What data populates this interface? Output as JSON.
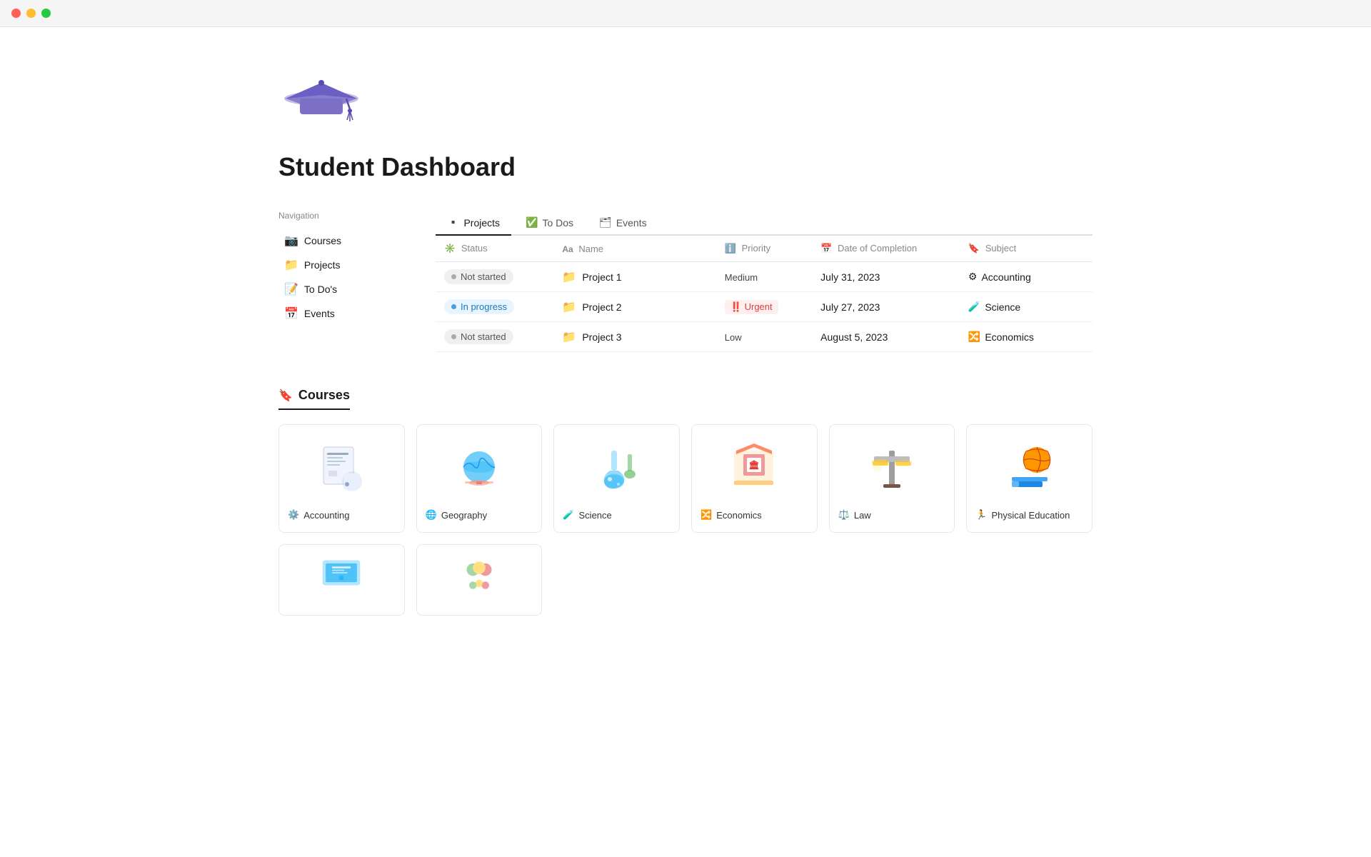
{
  "titlebar": {
    "buttons": [
      "close",
      "minimize",
      "maximize"
    ]
  },
  "page": {
    "icon": "🎓",
    "title": "Student Dashboard"
  },
  "navigation": {
    "heading": "Navigation",
    "items": [
      {
        "id": "courses",
        "icon": "📷",
        "label": "Courses"
      },
      {
        "id": "projects",
        "icon": "📁",
        "label": "Projects"
      },
      {
        "id": "todos",
        "icon": "📝",
        "label": "To Do's"
      },
      {
        "id": "events",
        "icon": "📅",
        "label": "Events"
      }
    ]
  },
  "tabs": [
    {
      "id": "projects",
      "icon": "▪",
      "label": "Projects",
      "active": true
    },
    {
      "id": "todos",
      "icon": "✓",
      "label": "To Dos",
      "active": false
    },
    {
      "id": "events",
      "icon": "▦",
      "label": "Events",
      "active": false
    }
  ],
  "table": {
    "columns": [
      {
        "id": "status",
        "icon": "✳",
        "label": "Status"
      },
      {
        "id": "name",
        "icon": "Aa",
        "label": "Name"
      },
      {
        "id": "priority",
        "icon": "ℹ",
        "label": "Priority"
      },
      {
        "id": "date",
        "icon": "📅",
        "label": "Date of Completion"
      },
      {
        "id": "subject",
        "icon": "🔖",
        "label": "Subject"
      }
    ],
    "rows": [
      {
        "status": "Not started",
        "statusType": "not-started",
        "name": "Project 1",
        "priority": "Medium",
        "priorityType": "medium",
        "date": "July 31, 2023",
        "subject": "Accounting",
        "subjectIcon": "⚙"
      },
      {
        "status": "In progress",
        "statusType": "in-progress",
        "name": "Project 2",
        "priority": "Urgent",
        "priorityType": "urgent",
        "date": "July 27, 2023",
        "subject": "Science",
        "subjectIcon": "🧪"
      },
      {
        "status": "Not started",
        "statusType": "not-started",
        "name": "Project 3",
        "priority": "Low",
        "priorityType": "low",
        "date": "August 5, 2023",
        "subject": "Economics",
        "subjectIcon": "🔀"
      }
    ]
  },
  "courses": {
    "heading": "Courses",
    "items": [
      {
        "id": "accounting",
        "label": "Accounting",
        "icon": "⚙",
        "emoji": "🧾"
      },
      {
        "id": "geography",
        "label": "Geography",
        "icon": "🌐",
        "emoji": "🌍"
      },
      {
        "id": "science",
        "label": "Science",
        "icon": "🧪",
        "emoji": "🔬"
      },
      {
        "id": "economics",
        "label": "Economics",
        "icon": "🔀",
        "emoji": "🏛"
      },
      {
        "id": "law",
        "label": "Law",
        "icon": "⚖",
        "emoji": "⚖"
      },
      {
        "id": "pe",
        "label": "Physical Education",
        "icon": "🏃",
        "emoji": "🏀"
      }
    ],
    "bottom_items": [
      {
        "id": "cs",
        "emoji": "💻"
      },
      {
        "id": "social",
        "emoji": "👥"
      }
    ]
  }
}
